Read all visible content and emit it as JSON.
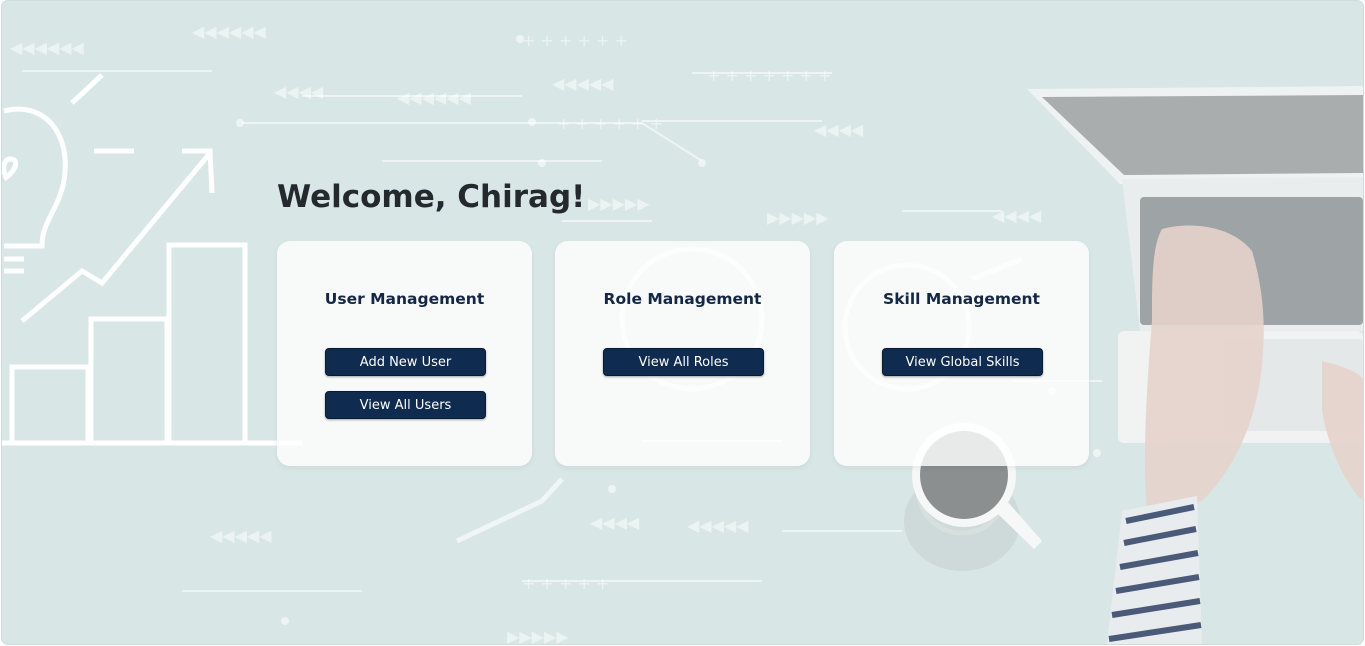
{
  "greeting": "Welcome, Chirag!",
  "cards": [
    {
      "title": "User Management",
      "buttons": [
        "Add New User",
        "View All Users"
      ]
    },
    {
      "title": "Role Management",
      "buttons": [
        "View All Roles"
      ]
    },
    {
      "title": "Skill Management",
      "buttons": [
        "View Global Skills"
      ]
    }
  ],
  "theme": {
    "background": "#d9e6e6",
    "button": "#0f2b4f",
    "heading": "#24292e",
    "card_title": "#142745"
  }
}
